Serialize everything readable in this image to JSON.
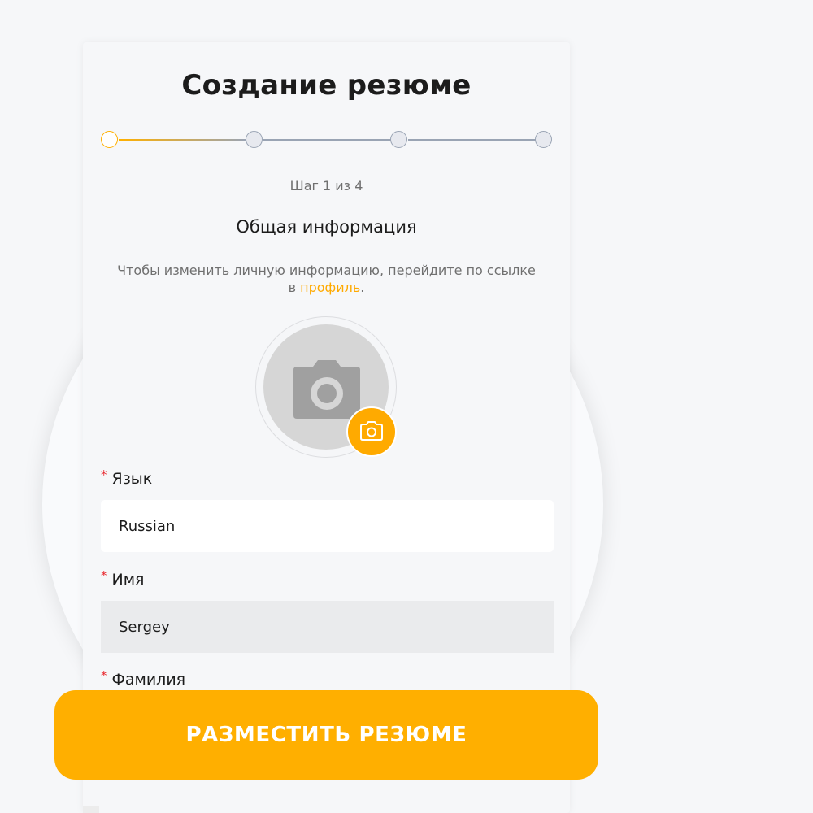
{
  "page": {
    "title": "Создание резюме",
    "step_info": "Шаг 1 из 4",
    "section_title": "Общая информация",
    "note_text": "Чтобы изменить личную информацию, перейдите по ссылке в ",
    "note_link": "профиль",
    "note_end": "."
  },
  "stepper": {
    "total_steps": 4,
    "current_step": 1
  },
  "avatar": {
    "placeholder_icon": "camera-icon",
    "upload_icon": "camera-icon"
  },
  "fields": {
    "language": {
      "label": "Язык",
      "required_mark": "*",
      "value": "Russian"
    },
    "first_name": {
      "label": "Имя",
      "required_mark": "*",
      "value": "Sergey"
    },
    "last_name": {
      "label": "Фамилия",
      "required_mark": "*"
    }
  },
  "cta": {
    "label": "РАЗМЕСТИТЬ РЕЗЮМЕ"
  },
  "colors": {
    "accent": "#ffaf00",
    "required": "#e8262d",
    "link": "#ffaa00"
  }
}
